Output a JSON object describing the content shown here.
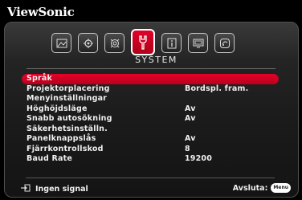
{
  "brand": "ViewSonic",
  "colors": {
    "accent": "#d4001f",
    "text": "#f0f0f0",
    "panel": "#1c1c1c"
  },
  "tabs": [
    {
      "icon": "picture-icon",
      "active": false
    },
    {
      "icon": "settings-gear-icon",
      "active": false
    },
    {
      "icon": "advanced-gear-icon",
      "active": false
    },
    {
      "icon": "system-tool-icon",
      "active": true
    },
    {
      "icon": "info-icon",
      "active": false
    },
    {
      "icon": "display-icon",
      "active": false
    },
    {
      "icon": "sound-icon",
      "active": false
    }
  ],
  "section_title": "SYSTEM",
  "menu": {
    "items": [
      {
        "label": "Språk",
        "value": "",
        "selected": true
      },
      {
        "label": "Projektorplacering",
        "value": "Bordspl. fram."
      },
      {
        "label": "Menyinställningar",
        "value": ""
      },
      {
        "label": "Höghöjdsläge",
        "value": "Av"
      },
      {
        "label": "Snabb autosökning",
        "value": "Av"
      },
      {
        "label": "Säkerhetsinställn.",
        "value": ""
      },
      {
        "label": "Panelknappslås",
        "value": "Av"
      },
      {
        "label": "Fjärrkontrollskod",
        "value": "8"
      },
      {
        "label": "Baud Rate",
        "value": "19200"
      }
    ]
  },
  "status": {
    "source_icon": "input-source-icon",
    "text": "Ingen signal"
  },
  "exit": {
    "label": "Avsluta:",
    "button": "Menu"
  }
}
